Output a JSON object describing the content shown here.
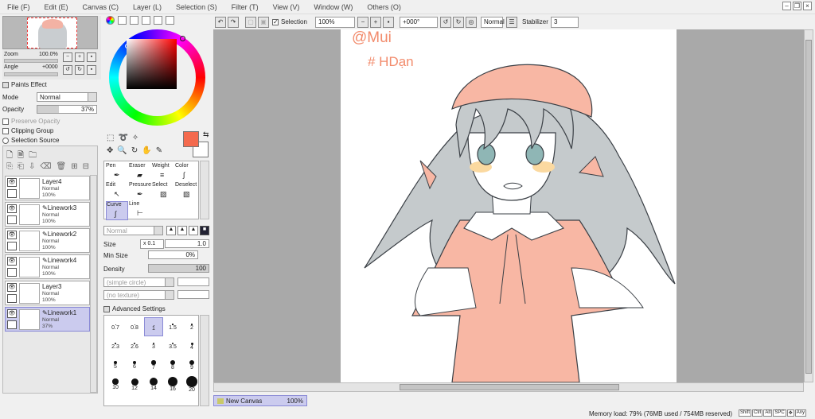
{
  "menu": [
    "File (F)",
    "Edit (E)",
    "Canvas (C)",
    "Layer (L)",
    "Selection (S)",
    "Filter (T)",
    "View (V)",
    "Window (W)",
    "Others (O)"
  ],
  "navigator": {
    "zoom_label": "Zoom",
    "zoom_value": "100.0%",
    "angle_label": "Angle",
    "angle_value": "+0000"
  },
  "paint_effect": {
    "header": "Paints Effect",
    "mode_label": "Mode",
    "mode_value": "Normal",
    "opacity_label": "Opacity",
    "opacity_value": "37%",
    "opacity_fraction": 0.37,
    "preserve_opacity": "Preserve Opacity",
    "clipping_group": "Clipping Group",
    "selection_source": "Selection Source"
  },
  "layers": [
    {
      "name": "Layer4",
      "mode": "Normal",
      "opacity": "100%",
      "selected": false,
      "linework": false
    },
    {
      "name": "Linework3",
      "mode": "Normal",
      "opacity": "100%",
      "selected": false,
      "linework": true
    },
    {
      "name": "Linework2",
      "mode": "Normal",
      "opacity": "100%",
      "selected": false,
      "linework": true
    },
    {
      "name": "Linework4",
      "mode": "Normal",
      "opacity": "100%",
      "selected": false,
      "linework": true
    },
    {
      "name": "Layer3",
      "mode": "Normal",
      "opacity": "100%",
      "selected": false,
      "linework": false
    },
    {
      "name": "Linework1",
      "mode": "Normal",
      "opacity": "37%",
      "selected": true,
      "linework": true
    }
  ],
  "colors": {
    "foreground": "#f46a4e",
    "background": "#ffffff",
    "accent_select": "#cbcbee"
  },
  "tools": [
    {
      "name": "Pen",
      "icon": "pen-icon"
    },
    {
      "name": "Eraser",
      "icon": "eraser-icon"
    },
    {
      "name": "Weight",
      "icon": "weight-icon"
    },
    {
      "name": "Color",
      "icon": "color-icon"
    },
    {
      "name": "Edit",
      "icon": "edit-icon"
    },
    {
      "name": "Pressure",
      "icon": "pressure-icon"
    },
    {
      "name": "Select",
      "icon": "select-icon"
    },
    {
      "name": "Deselect",
      "icon": "deselect-icon"
    },
    {
      "name": "Curve",
      "icon": "curve-icon",
      "selected": true
    },
    {
      "name": "Line",
      "icon": "line-icon"
    }
  ],
  "brush": {
    "blend_mode": "Normal",
    "size_label": "Size",
    "size_mult": "x 0.1",
    "size_value": "1.0",
    "min_size_label": "Min Size",
    "min_size_value": "0%",
    "density_label": "Density",
    "density_value": "100",
    "shape": "(simple circle)",
    "texture": "(no texture)",
    "advanced": "Advanced Settings"
  },
  "brush_sizes": [
    "0.7",
    "0.8",
    "1",
    "1.5",
    "2",
    "2.3",
    "2.6",
    "3",
    "3.5",
    "4",
    "5",
    "6",
    "7",
    "8",
    "9",
    "10",
    "12",
    "14",
    "16",
    "20"
  ],
  "selected_brush_size": "1",
  "toolbar": {
    "selection_label": "Selection",
    "zoom": "100%",
    "rotation": "+000°",
    "blend": "Normal",
    "stabilizer_label": "Stabilizer",
    "stabilizer_value": "3"
  },
  "canvas": {
    "text1": "@Mui",
    "text2": "# HDạn"
  },
  "canvas_tab": {
    "name": "New Canvas",
    "zoom": "100%"
  },
  "status": {
    "memory": "Memory load: 79% (76MB used / 754MB reserved)",
    "keys": [
      "Shift",
      "Ctrl",
      "Alt",
      "SPC",
      "✥",
      "Any"
    ]
  }
}
